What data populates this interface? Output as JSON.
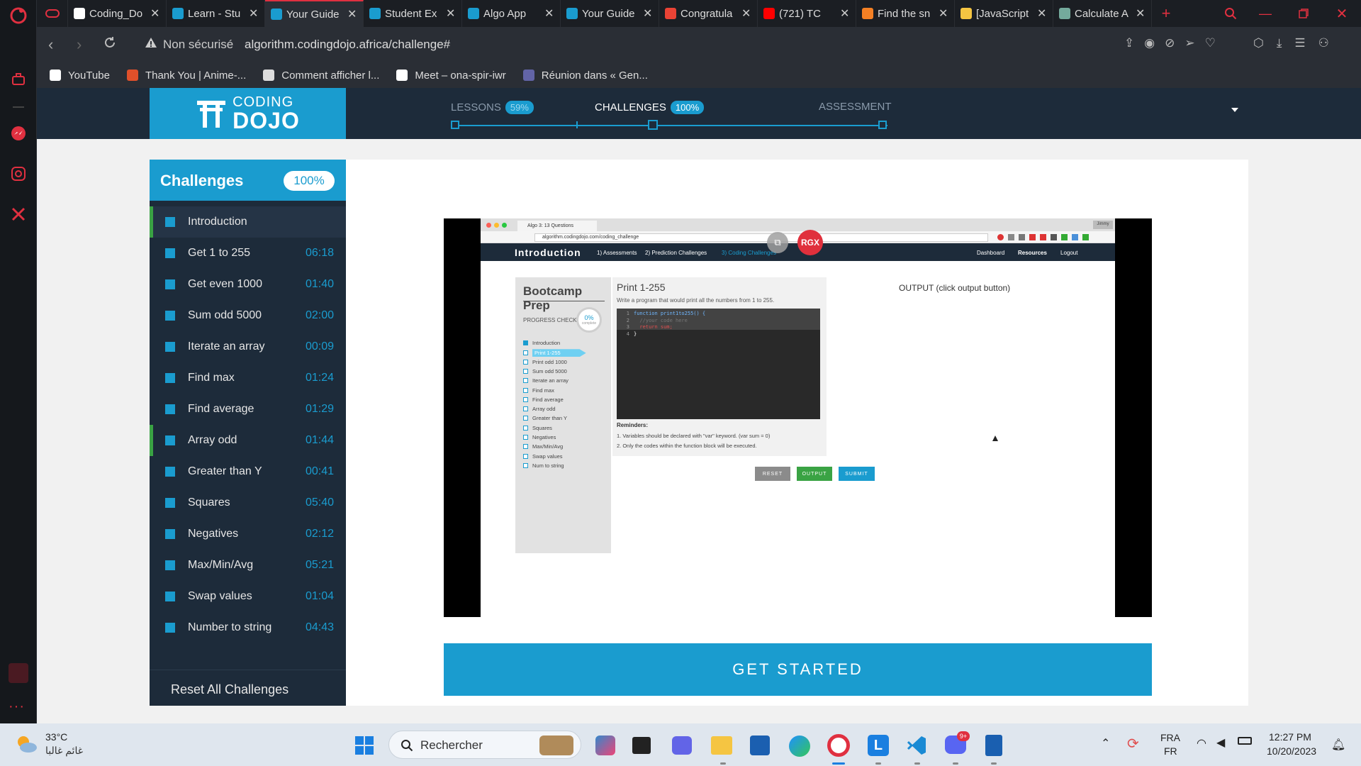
{
  "browser": {
    "tabs": [
      {
        "label": "Coding_Do",
        "icon": "github-icon",
        "color": "#ffffff",
        "active": false
      },
      {
        "label": "Learn - Stu",
        "icon": "dojo-icon",
        "color": "#1a9ccf",
        "active": false
      },
      {
        "label": "Your Guide",
        "icon": "dojo-icon",
        "color": "#1a9ccf",
        "active": true
      },
      {
        "label": "Student Ex",
        "icon": "dojo-icon",
        "color": "#1a9ccf",
        "active": false
      },
      {
        "label": "Algo App",
        "icon": "dojo-icon",
        "color": "#1a9ccf",
        "active": false
      },
      {
        "label": "Your Guide",
        "icon": "dojo-icon",
        "color": "#1a9ccf",
        "active": false
      },
      {
        "label": "Congratula",
        "icon": "gmail-icon",
        "color": "#ea4335",
        "active": false
      },
      {
        "label": "(721) TC",
        "icon": "youtube-icon",
        "color": "#ff0000",
        "active": false
      },
      {
        "label": "Find the sn",
        "icon": "stackoverflow-icon",
        "color": "#f48024",
        "active": false
      },
      {
        "label": "[JavaScript",
        "icon": "codewars-icon",
        "color": "#f5c542",
        "active": false
      },
      {
        "label": "Calculate A",
        "icon": "chatgpt-icon",
        "color": "#74aa9c",
        "active": false
      }
    ],
    "security_label": "Non sécurisé",
    "url": "algorithm.codingdojo.africa/challenge#",
    "bookmarks": [
      {
        "label": "YouTube",
        "icon": "page-icon",
        "color": "#ffffff"
      },
      {
        "label": "Thank You | Anime-...",
        "icon": "anime-icon",
        "color": "#e0502a"
      },
      {
        "label": "Comment afficher l...",
        "icon": "wordpress-icon",
        "color": "#dddddd"
      },
      {
        "label": "Meet – ona-spir-iwr",
        "icon": "page-icon",
        "color": "#ffffff"
      },
      {
        "label": "Réunion dans « Gen...",
        "icon": "teams-icon",
        "color": "#6264a7"
      }
    ]
  },
  "site": {
    "logo_top": "CODING",
    "logo_bottom": "DOJO",
    "progress": [
      {
        "label": "LESSONS",
        "badge": "59%",
        "active": false
      },
      {
        "label": "CHALLENGES",
        "badge": "100%",
        "active": true
      },
      {
        "label": "ASSESSMENT",
        "badge": "",
        "active": false
      }
    ]
  },
  "challenges": {
    "title": "Challenges",
    "badge": "100%",
    "items": [
      {
        "name": "Introduction",
        "time": "",
        "current": true,
        "accent": true
      },
      {
        "name": "Get 1 to 255",
        "time": "06:18",
        "current": false,
        "accent": false
      },
      {
        "name": "Get even 1000",
        "time": "01:40",
        "current": false,
        "accent": false
      },
      {
        "name": "Sum odd 5000",
        "time": "02:00",
        "current": false,
        "accent": false
      },
      {
        "name": "Iterate an array",
        "time": "00:09",
        "current": false,
        "accent": false
      },
      {
        "name": "Find max",
        "time": "01:24",
        "current": false,
        "accent": false
      },
      {
        "name": "Find average",
        "time": "01:29",
        "current": false,
        "accent": false
      },
      {
        "name": "Array odd",
        "time": "01:44",
        "current": false,
        "accent": true
      },
      {
        "name": "Greater than Y",
        "time": "00:41",
        "current": false,
        "accent": false
      },
      {
        "name": "Squares",
        "time": "05:40",
        "current": false,
        "accent": false
      },
      {
        "name": "Negatives",
        "time": "02:12",
        "current": false,
        "accent": false
      },
      {
        "name": "Max/Min/Avg",
        "time": "05:21",
        "current": false,
        "accent": false
      },
      {
        "name": "Swap values",
        "time": "01:04",
        "current": false,
        "accent": false
      },
      {
        "name": "Number to string",
        "time": "04:43",
        "current": false,
        "accent": false
      }
    ],
    "reset_label": "Reset All Challenges"
  },
  "video": {
    "inner_tab": "Algo 3: 13 Questions",
    "inner_url": "algorithm.codingdojo.com/coding_challenge",
    "user_chip": "Jimmy",
    "rgx_badge": "RGX",
    "nav_title": "Introduction",
    "nav_links": [
      "1) Assessments",
      "2) Prediction Challenges",
      "3) Coding Challenges"
    ],
    "nav_right": [
      "Dashboard",
      "Resources",
      "Logout"
    ],
    "prep_title": "Bootcamp Prep",
    "progress_check": "PROGRESS CHECK",
    "progress_pct": "0%",
    "progress_sub": "complete",
    "prep_items": [
      "Introduction",
      "Print 1-255",
      "Print odd 1000",
      "Sum odd 5000",
      "Iterate an array",
      "Find max",
      "Find average",
      "Array odd",
      "Greater than Y",
      "Squares",
      "Negatives",
      "Max/Min/Avg",
      "Swap values",
      "Num to string"
    ],
    "problem_title": "Print 1-255",
    "problem_desc": "Write a program that would print all the numbers from 1 to 255.",
    "code_lines": [
      {
        "num": "1",
        "text": "function print1to255() {"
      },
      {
        "num": "2",
        "text": "  //your code here"
      },
      {
        "num": "3",
        "text": "  return sum;"
      },
      {
        "num": "4",
        "text": "}"
      }
    ],
    "reminders_title": "Reminders:",
    "reminders": [
      "1. Variables should be declared with \"var\" keyword. (var sum = 0)",
      "2. Only the codes within the function block will be executed."
    ],
    "buttons": [
      "RESET",
      "OUTPUT",
      "SUBMIT"
    ],
    "output_label": "OUTPUT (click output button)"
  },
  "get_started": "GET STARTED",
  "taskbar": {
    "temperature": "33°C",
    "weather": "غائم غالبا",
    "search_placeholder": "Rechercher",
    "lang_top": "FRA",
    "lang_bottom": "FR",
    "time": "12:27 PM",
    "date": "10/20/2023",
    "discord_badge": "9+"
  }
}
